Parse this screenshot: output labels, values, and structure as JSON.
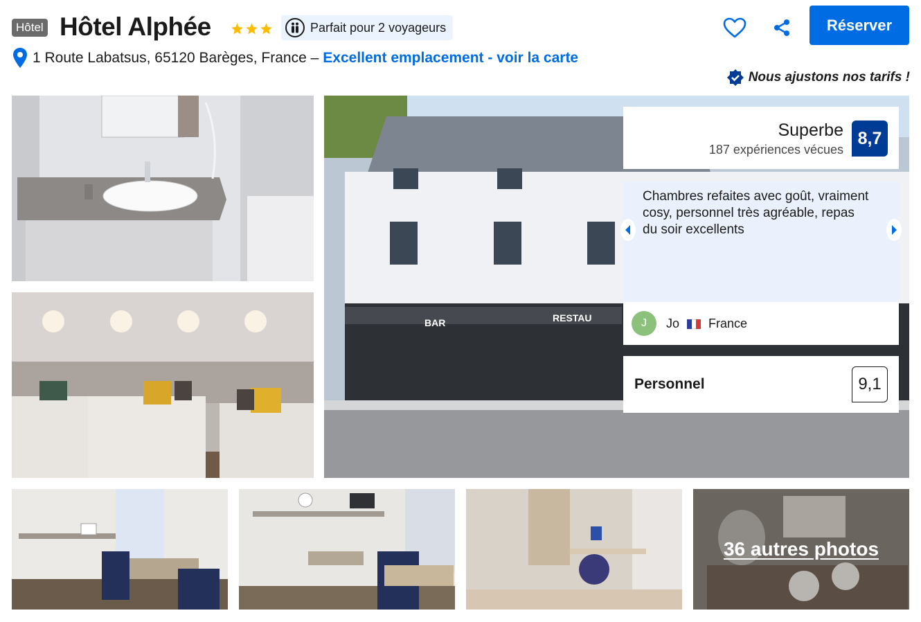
{
  "header": {
    "type_badge": "Hôtel",
    "hotel_name": "Hôtel Alphée",
    "stars": 3,
    "traveler_pill": "Parfait pour 2 voyageurs",
    "reserve_label": "Réserver",
    "price_match": "Nous ajustons nos tarifs !"
  },
  "address": {
    "text": "1 Route Labatsus, 65120 Barèges, France –",
    "map_link": "Excellent emplacement - voir la carte"
  },
  "review": {
    "rating_word": "Superbe",
    "review_count": "187 expériences vécues",
    "score": "8,7",
    "quote": "Chambres refaites avec goût, vraiment cosy, personnel très agréable, repas du soir excellents",
    "reviewer_initial": "J",
    "reviewer_name": "Jo",
    "reviewer_country": "France",
    "category_label": "Personnel",
    "category_score": "9,1"
  },
  "gallery": {
    "more_photos": "36 autres photos"
  },
  "colors": {
    "brand_blue": "#006ce4",
    "score_navy": "#003b95",
    "star_yellow": "#febb02",
    "quote_bg": "#eaf1fc",
    "avatar_green": "#8cc17b"
  }
}
